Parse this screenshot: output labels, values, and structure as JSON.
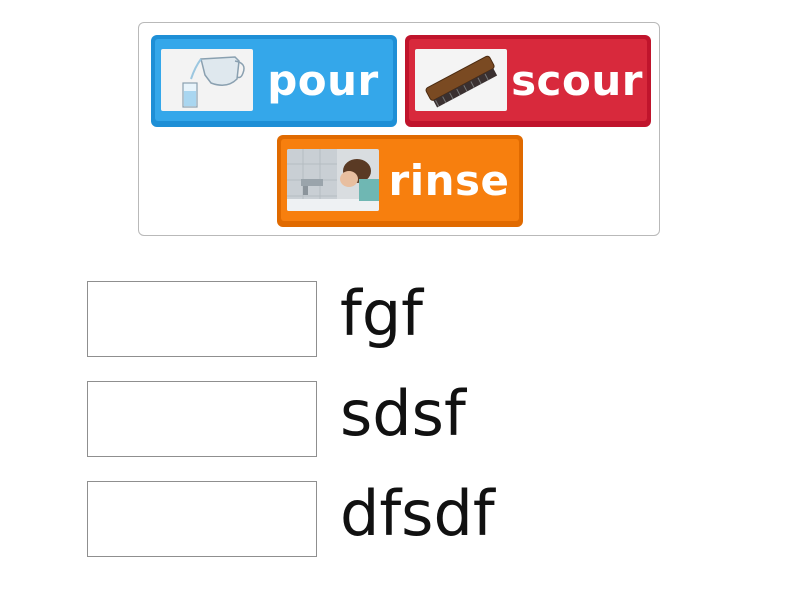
{
  "tiles": [
    {
      "label": "pour",
      "color": "#34a7ea",
      "icon": "water-pitcher-icon"
    },
    {
      "label": "scour",
      "color": "#d8293c",
      "icon": "scrub-brush-icon"
    },
    {
      "label": "rinse",
      "color": "#f77f0e",
      "icon": "face-rinse-photo-icon"
    }
  ],
  "targets": [
    {
      "label": "fgf"
    },
    {
      "label": "sdsf"
    },
    {
      "label": "dfsdf"
    }
  ]
}
